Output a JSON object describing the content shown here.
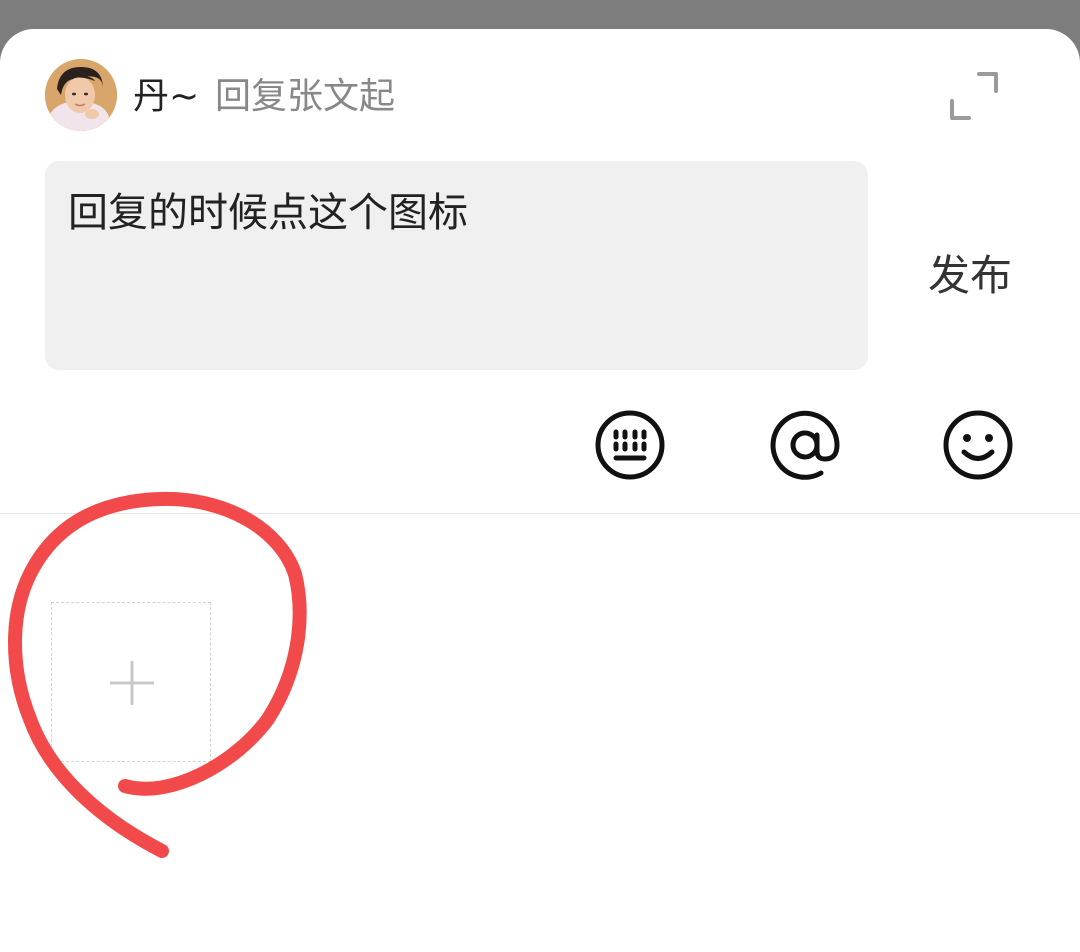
{
  "header": {
    "username": "丹~",
    "reply_to": "回复张文起"
  },
  "compose": {
    "text": "回复的时候点这个图标",
    "publish_label": "发布"
  },
  "toolbar": {
    "icons": [
      "keyboard-icon",
      "at-icon",
      "emoji-icon"
    ]
  },
  "attachments": {
    "add_icon": "plus-icon"
  },
  "colors": {
    "annotation": "#f24a4a",
    "input_bg": "#f0f0f0",
    "overlay": "#7d7d7d"
  }
}
